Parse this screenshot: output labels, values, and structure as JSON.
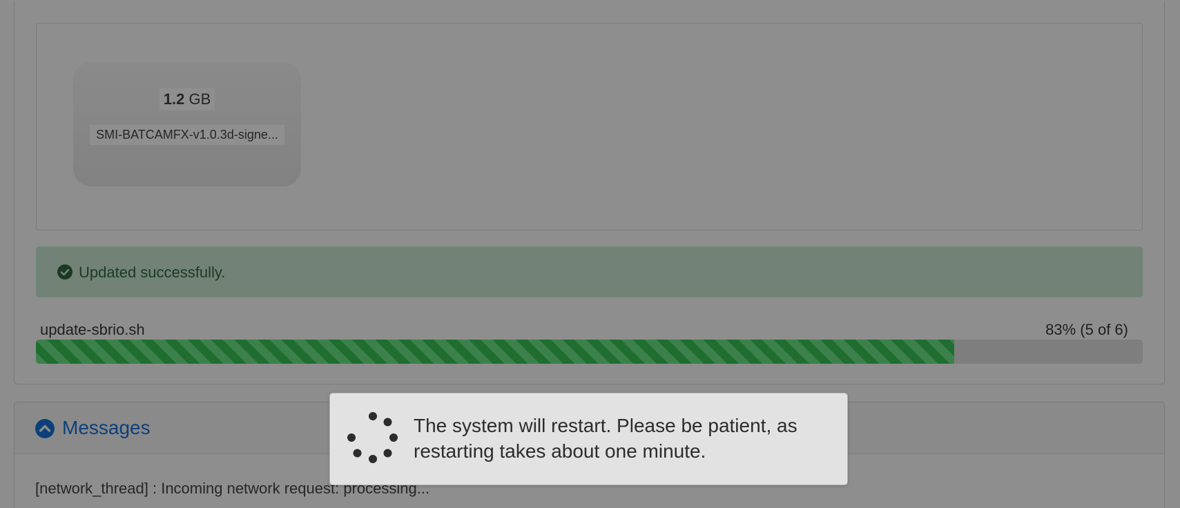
{
  "upload": {
    "file_size_value": "1.2",
    "file_size_unit": "GB",
    "file_name": "SMI-BATCAMFX-v1.0.3d-signe..."
  },
  "alert": {
    "message": "Updated successfully.",
    "icon": "check-circle-icon"
  },
  "progress": {
    "file": "update-sbrio.sh",
    "status_text": "83% (5 of 6)",
    "fraction": 0.83,
    "color": "#1f6e30"
  },
  "messages": {
    "title": "Messages",
    "toggle_icon": "chevron-up-circle-icon",
    "log_line": "[network_thread] : Incoming network request: processing..."
  },
  "modal": {
    "text": "The system will restart. Please be patient, as restarting takes about one minute.",
    "icon": "loading-spinner-icon"
  }
}
